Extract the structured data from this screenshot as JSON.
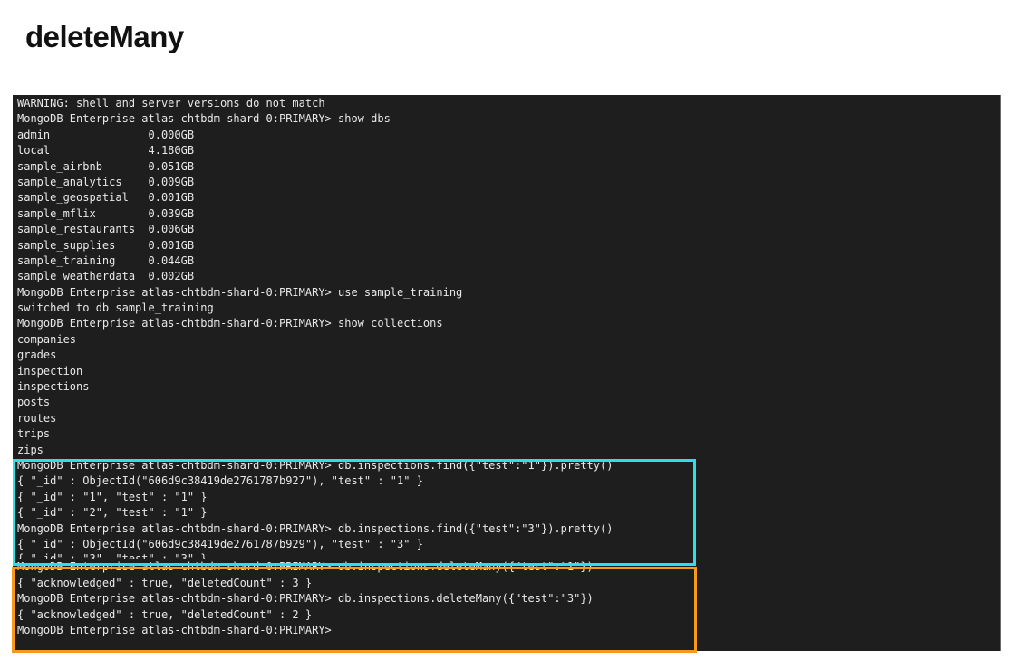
{
  "title": "deleteMany",
  "terminal": {
    "lines": [
      "WARNING: shell and server versions do not match",
      "MongoDB Enterprise atlas-chtbdm-shard-0:PRIMARY> show dbs",
      "admin               0.000GB",
      "local               4.180GB",
      "sample_airbnb       0.051GB",
      "sample_analytics    0.009GB",
      "sample_geospatial   0.001GB",
      "sample_mflix        0.039GB",
      "sample_restaurants  0.006GB",
      "sample_supplies     0.001GB",
      "sample_training     0.044GB",
      "sample_weatherdata  0.002GB",
      "MongoDB Enterprise atlas-chtbdm-shard-0:PRIMARY> use sample_training",
      "switched to db sample_training",
      "MongoDB Enterprise atlas-chtbdm-shard-0:PRIMARY> show collections",
      "companies",
      "grades",
      "inspection",
      "inspections",
      "posts",
      "routes",
      "trips",
      "zips",
      "MongoDB Enterprise atlas-chtbdm-shard-0:PRIMARY> db.inspections.find({\"test\":\"1\"}).pretty()",
      "{ \"_id\" : ObjectId(\"606d9c38419de2761787b927\"), \"test\" : \"1\" }",
      "{ \"_id\" : \"1\", \"test\" : \"1\" }",
      "{ \"_id\" : \"2\", \"test\" : \"1\" }",
      "MongoDB Enterprise atlas-chtbdm-shard-0:PRIMARY> db.inspections.find({\"test\":\"3\"}).pretty()",
      "{ \"_id\" : ObjectId(\"606d9c38419de2761787b929\"), \"test\" : \"3\" }",
      "{ \"_id\" : \"3\", \"test\" : \"3\" }",
      "MongoDB Enterprise atlas-chtbdm-shard-0:PRIMARY> db.inspections.deleteMany({\"test\":\"1\"})",
      "{ \"acknowledged\" : true, \"deletedCount\" : 3 }",
      "MongoDB Enterprise atlas-chtbdm-shard-0:PRIMARY> db.inspections.deleteMany({\"test\":\"3\"})",
      "{ \"acknowledged\" : true, \"deletedCount\" : 2 }",
      "MongoDB Enterprise atlas-chtbdm-shard-0:PRIMARY>"
    ]
  },
  "colors": {
    "terminal_bg": "#1e1e1e",
    "terminal_text": "#e8e8e8",
    "highlight_find": "#2ee0e6",
    "highlight_delete": "#f59a1b"
  }
}
